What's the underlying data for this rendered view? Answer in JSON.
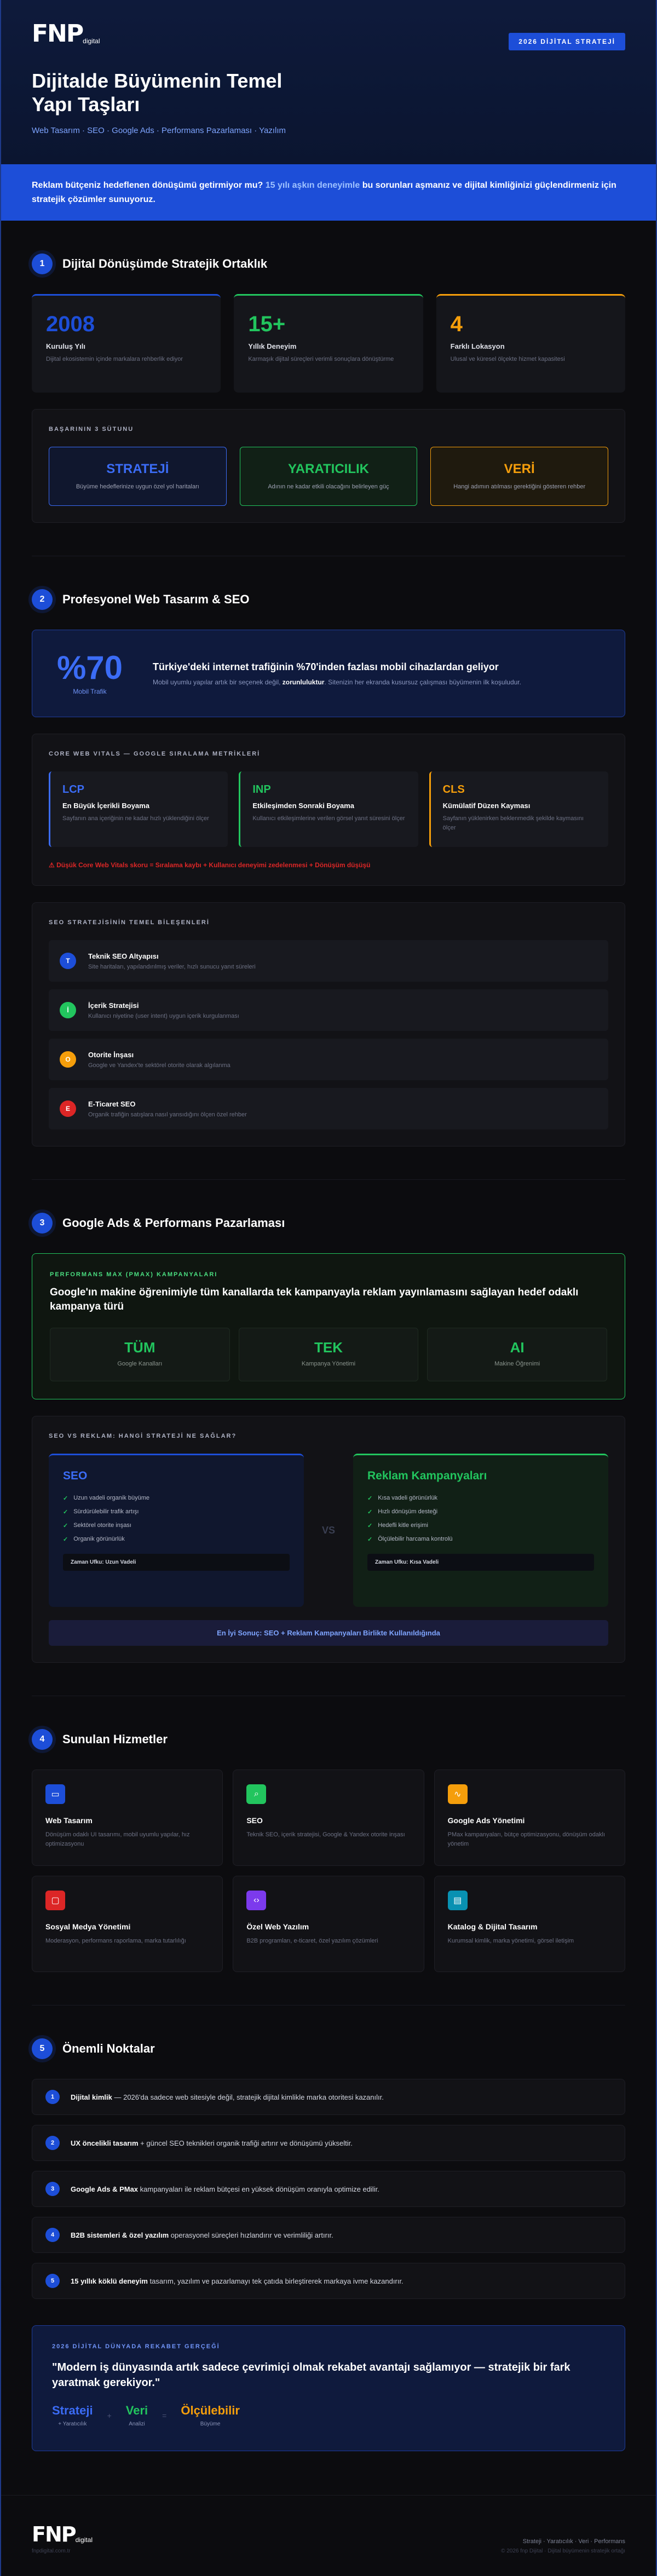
{
  "hero": {
    "logo_mark": "FNP",
    "logo_sub": "digital",
    "badge": "2026 DİJİTAL STRATEJİ",
    "title": "Dijitalde Büyümenin Temel Yapı Taşları",
    "subtitle": "Web Tasarım · SEO · Google Ads · Performans Pazarlaması · Yazılım"
  },
  "banner": {
    "part1": "Reklam bütçeniz hedeflenen dönüşümü getirmiyor mu? ",
    "highlight": "15 yılı aşkın deneyimle",
    "part2": " bu sorunları aşmanız ve dijital kimliğinizi güçlendirmeniz için stratejik çözümler sunuyoruz."
  },
  "s1": {
    "num": "1",
    "title": "Dijital Dönüşümde Stratejik Ortaklık",
    "stats": [
      {
        "value": "2008",
        "label": "Kuruluş Yılı",
        "desc": "Dijital ekosistemin içinde markalara rehberlik ediyor",
        "color": "#1d4ed8"
      },
      {
        "value": "15+",
        "label": "Yıllık Deneyim",
        "desc": "Karmaşık dijital süreçleri verimli sonuçlara dönüştürme",
        "color": "#22c55e"
      },
      {
        "value": "4",
        "label": "Farklı Lokasyon",
        "desc": "Ulusal ve küresel ölçekte hizmet kapasitesi",
        "color": "#f59e0b"
      }
    ],
    "pillars_label": "BAŞARININ 3 SÜTUNU",
    "pillars": [
      {
        "title": "STRATEJİ",
        "desc": "Büyüme hedeflerinize uygun özel yol haritaları",
        "color": "#3b6cf6",
        "bg": "#10172e"
      },
      {
        "title": "YARATICILIK",
        "desc": "Adının ne kadar etkili olacağını belirleyen güç",
        "color": "#22c55e",
        "bg": "#112016"
      },
      {
        "title": "VERİ",
        "desc": "Hangi adımın atılması gerektiğini gösteren rehber",
        "color": "#f59e0b",
        "bg": "#1f1a0e"
      }
    ]
  },
  "s2": {
    "num": "2",
    "title": "Profesyonel Web Tasarım & SEO",
    "mobile": {
      "value": "%70",
      "label": "Mobil Trafik",
      "headline": "Türkiye'deki internet trafiğinin %70'inden fazlası mobil cihazlardan geliyor",
      "desc_pre": "Mobil uyumlu yapılar artık bir seçenek değil, ",
      "desc_bold": "zorunluluktur",
      "desc_post": ". Sitenizin her ekranda kusursuz çalışması büyümenin ilk koşuludur."
    },
    "cwv_label": "CORE WEB VITALS — GOOGLE SIRALAMA METRİKLERİ",
    "cwv": [
      {
        "key": "LCP",
        "name": "En Büyük İçerikli Boyama",
        "desc": "Sayfanın ana içeriğinin ne kadar hızlı yüklendiğini ölçer",
        "color": "#3b6cf6"
      },
      {
        "key": "INP",
        "name": "Etkileşimden Sonraki Boyama",
        "desc": "Kullanıcı etkileşimlerine verilen görsel yanıt süresini ölçer",
        "color": "#22c55e"
      },
      {
        "key": "CLS",
        "name": "Kümülatif Düzen Kayması",
        "desc": "Sayfanın yüklenirken beklenmedik şekilde kaymasını ölçer",
        "color": "#f59e0b"
      }
    ],
    "cwv_warning": "⚠ Düşük Core Web Vitals skoru = Sıralama kaybı + Kullanıcı deneyimi zedelenmesi + Dönüşüm düşüşü",
    "seo_label": "SEO STRATEJİSİNİN TEMEL BİLEŞENLERİ",
    "seo": [
      {
        "mark": "T",
        "title": "Teknik SEO Altyapısı",
        "desc": "Site haritaları, yapılandırılmış veriler, hızlı sunucu yanıt süreleri",
        "color": "#1d4ed8"
      },
      {
        "mark": "İ",
        "title": "İçerik Stratejisi",
        "desc": "Kullanıcı niyetine (user intent) uygun içerik kurgulanması",
        "color": "#22c55e"
      },
      {
        "mark": "O",
        "title": "Otorite İnşası",
        "desc": "Google ve Yandex'te sektörel otorite olarak algılanma",
        "color": "#f59e0b"
      },
      {
        "mark": "E",
        "title": "E-Ticaret SEO",
        "desc": "Organik trafiğin satışlara nasıl yansıdığını ölçen özel rehber",
        "color": "#dc2626"
      }
    ]
  },
  "s3": {
    "num": "3",
    "title": "Google Ads & Performans Pazarlaması",
    "pmax_label": "PERFORMANS MAX (PMAX) KAMPANYALARI",
    "pmax_text": "Google'ın makine öğrenimiyle tüm kanallarda tek kampanyayla reklam yayınlamasını sağlayan hedef odaklı kampanya türü",
    "pmax_boxes": [
      {
        "value": "TÜM",
        "label": "Google Kanalları"
      },
      {
        "value": "TEK",
        "label": "Kampanya Yönetimi"
      },
      {
        "value": "AI",
        "label": "Makine Öğrenimi"
      }
    ],
    "vs_label": "SEO VS REKLAM: HANGİ STRATEJİ NE SAĞLAR?",
    "vs_mid": "VS",
    "seo_card": {
      "title": "SEO",
      "items": [
        "Uzun vadeli organik büyüme",
        "Sürdürülebilir trafik artışı",
        "Sektörel otorite inşası",
        "Organik görünürlük"
      ],
      "foot": "Zaman Ufku: Uzun Vadeli"
    },
    "ads_card": {
      "title": "Reklam Kampanyaları",
      "items": [
        "Kısa vadeli görünürlük",
        "Hızlı dönüşüm desteği",
        "Hedefli kitle erişimi",
        "Ölçülebilir harcama kontrolü"
      ],
      "foot": "Zaman Ufku: Kısa Vadeli"
    },
    "result": "En İyi Sonuç: SEO + Reklam Kampanyaları Birlikte Kullanıldığında"
  },
  "s4": {
    "num": "4",
    "title": "Sunulan Hizmetler",
    "services": [
      {
        "icon": "monitor-icon",
        "glyph": "▭",
        "title": "Web Tasarım",
        "desc": "Dönüşüm odaklı UI tasarımı, mobil uyumlu yapılar, hız optimizasyonu",
        "color": "#1d4ed8"
      },
      {
        "icon": "search-icon",
        "glyph": "⌕",
        "title": "SEO",
        "desc": "Teknik SEO, içerik stratejisi, Google & Yandex otorite inşası",
        "color": "#22c55e"
      },
      {
        "icon": "activity-icon",
        "glyph": "∿",
        "title": "Google Ads Yönetimi",
        "desc": "PMax kampanyaları, bütçe optimizasyonu, dönüşüm odaklı yönetim",
        "color": "#f59e0b"
      },
      {
        "icon": "chat-icon",
        "glyph": "▢",
        "title": "Sosyal Medya Yönetimi",
        "desc": "Moderasyon, performans raporlama, marka tutarlılığı",
        "color": "#dc2626"
      },
      {
        "icon": "code-icon",
        "glyph": "‹›",
        "title": "Özel Web Yazılım",
        "desc": "B2B programları, e-ticaret, özel yazılım çözümleri",
        "color": "#7c3aed"
      },
      {
        "icon": "book-icon",
        "glyph": "▤",
        "title": "Katalog & Dijital Tasarım",
        "desc": "Kurumsal kimlik, marka yönetimi, görsel iletişim",
        "color": "#0891b2"
      }
    ]
  },
  "s5": {
    "num": "5",
    "title": "Önemli Noktalar",
    "notes": [
      {
        "n": "1",
        "bold": "Dijital kimlik",
        "rest": " — 2026'da sadece web sitesiyle değil, stratejik dijital kimlikle marka otoritesi kazanılır."
      },
      {
        "n": "2",
        "bold": "UX öncelikli tasarım",
        "rest": " + güncel SEO teknikleri organik trafiği artırır ve dönüşümü yükseltir."
      },
      {
        "n": "3",
        "bold": "Google Ads & PMax",
        "rest": " kampanyaları ile reklam bütçesi en yüksek dönüşüm oranıyla optimize edilir."
      },
      {
        "n": "4",
        "bold": "B2B sistemleri & özel yazılım",
        "rest": " operasyonel süreçleri hızlandırır ve verimliliği artırır."
      },
      {
        "n": "5",
        "bold": "15 yıllık köklü deneyim",
        "rest": " tasarım, yazılım ve pazarlamayı tek çatıda birleştirerek markaya ivme kazandırır."
      }
    ],
    "quote_label": "2026 DİJİTAL DÜNYADA REKABET GERÇEĞİ",
    "quote": "\"Modern iş dünyasında artık sadece çevrimiçi olmak rekabet avantajı sağlamıyor — stratejik bir fark yaratmak gerekiyor.\"",
    "triad": [
      {
        "value": "Strateji",
        "label": "+ Yaratıcılık",
        "color": "#3b6cf6"
      },
      {
        "value": "Veri",
        "label": "Analizi",
        "color": "#22c55e"
      },
      {
        "value": "Ölçülebilir",
        "label": "Büyüme",
        "color": "#f59e0b"
      }
    ],
    "plus": "+",
    "eq": "="
  },
  "footer": {
    "logo_mark": "FNP",
    "logo_sub": "digital",
    "caption": "fnpdigital.com.tr",
    "links": "Strateji · Yaratıcılık · Veri · Performans",
    "copyright": "© 2026 fnp Dijital · Dijital büyümenin stratejik ortağı"
  }
}
